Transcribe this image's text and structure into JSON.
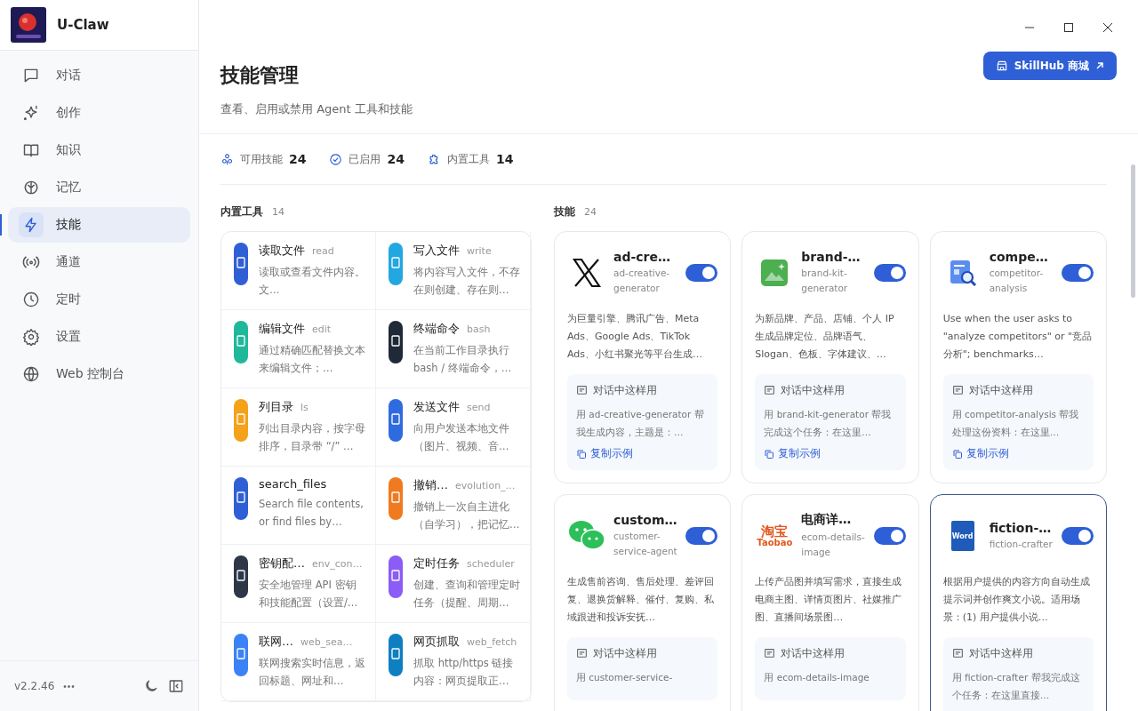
{
  "app": {
    "name": "U-Claw",
    "version": "v2.2.46",
    "more": "•••"
  },
  "sidebar": {
    "items": [
      {
        "label": "对话",
        "selected": false
      },
      {
        "label": "创作",
        "selected": false
      },
      {
        "label": "知识",
        "selected": false
      },
      {
        "label": "记忆",
        "selected": false
      },
      {
        "label": "技能",
        "selected": true
      },
      {
        "label": "通道",
        "selected": false
      },
      {
        "label": "定时",
        "selected": false
      },
      {
        "label": "设置",
        "selected": false
      },
      {
        "label": "Web 控制台",
        "selected": false
      }
    ]
  },
  "header": {
    "title": "技能管理",
    "subtitle": "查看、启用或禁用 Agent 工具和技能",
    "store_button": "SkillHub 商城"
  },
  "stats": [
    {
      "label": "可用技能",
      "value": "24"
    },
    {
      "label": "已启用",
      "value": "24"
    },
    {
      "label": "内置工具",
      "value": "14"
    }
  ],
  "tools_section": {
    "title": "内置工具",
    "count": "14",
    "tools": [
      {
        "name": "读取文件",
        "id": "read",
        "description": "读取或查看文件内容。文…",
        "color": "#2f5fd6"
      },
      {
        "name": "写入文件",
        "id": "write",
        "description": "将内容写入文件，不存在则创建、存在则…",
        "color": "#22a7e0"
      },
      {
        "name": "编辑文件",
        "id": "edit",
        "description": "通过精确匹配替换文本来编辑文件；…",
        "color": "#1fb89a"
      },
      {
        "name": "终端命令",
        "id": "bash",
        "description": "在当前工作目录执行 bash / 终端命令，…",
        "color": "#1f2937"
      },
      {
        "name": "列目录",
        "id": "ls",
        "description": "列出目录内容，按字母排序，目录带 “/” …",
        "color": "#f4a21a"
      },
      {
        "name": "发送文件",
        "id": "send",
        "description": "向用户发送本地文件（图片、视频、音…",
        "color": "#2f6be0"
      },
      {
        "name": "search_files",
        "description": "Search file contents, or find files by…",
        "color": "#2f5fd6"
      },
      {
        "name": "撤销…",
        "id": "evolution_…",
        "description": "撤销上一次自主进化（自学习），把记忆…",
        "color": "#f07a1f"
      },
      {
        "name": "密钥配…",
        "id": "env_con…",
        "description": "安全地管理 API 密钥和技能配置（设置/…",
        "color": "#2d3748"
      },
      {
        "name": "定时任务",
        "id": "scheduler",
        "description": "创建、查询和管理定时任务（提醒、周期…",
        "color": "#8b5cf6"
      },
      {
        "name": "联网…",
        "id": "web_sea…",
        "description": "联网搜索实时信息，返回标题、网址和…",
        "color": "#3b82f6"
      },
      {
        "name": "网页抓取",
        "id": "web_fetch",
        "description": "抓取 http/https 链接内容：网页提取正…",
        "color": "#0e7fc1"
      }
    ]
  },
  "skills_section": {
    "title": "技能",
    "count": "24",
    "skills": [
      {
        "title": "ad-cre…",
        "slug": "ad-creative-generator",
        "on": true,
        "description": "为巨量引擎、腾讯广告、Meta Ads、Google Ads、TikTok Ads、小红书聚光等平台生成…",
        "usage_title": "对话中这样用",
        "usage": "用 ad-creative-generator 帮我生成内容，主题是：…",
        "copy": "复制示例",
        "selected": false
      },
      {
        "title": "brand-…",
        "slug": "brand-kit-generator",
        "on": true,
        "description": "为新品牌、产品、店铺、个人 IP 生成品牌定位、品牌语气、Slogan、色板、字体建议、…",
        "usage_title": "对话中这样用",
        "usage": "用 brand-kit-generator 帮我完成这个任务：在这里…",
        "copy": "复制示例",
        "selected": false
      },
      {
        "title": "compe…",
        "slug": "competitor-analysis",
        "on": true,
        "description": "Use when the user asks to \"analyze competitors\" or \"竞品分析\"; benchmarks…",
        "usage_title": "对话中这样用",
        "usage": "用 competitor-analysis 帮我处理这份资料：在这里…",
        "copy": "复制示例",
        "selected": false
      },
      {
        "title": "custom…",
        "slug": "customer-service-agent",
        "on": true,
        "description": "生成售前咨询、售后处理、差评回复、退换货解释、催付、复购、私域跟进和投诉安抚…",
        "usage_title": "对话中这样用",
        "usage": "用 customer-service-",
        "selected": false
      },
      {
        "title": "电商详…",
        "slug": "ecom-details-image",
        "on": true,
        "logo_text": [
          "淘宝",
          "Taobao"
        ],
        "description": "上传产品图并填写需求，直接生成电商主图、详情页图片、社媒推广图、直播间场景图…",
        "usage_title": "对话中这样用",
        "usage": "用 ecom-details-image",
        "selected": false
      },
      {
        "title": "fiction-…",
        "slug": "fiction-crafter",
        "on": true,
        "logo_text": [
          "Word"
        ],
        "description": "根据用户提供的内容方向自动生成提示词并创作爽文小说。适用场景：(1) 用户提供小说…",
        "usage_title": "对话中这样用",
        "usage": "用 fiction-crafter 帮我完成这个任务：在这里直接…",
        "selected": true
      }
    ]
  }
}
